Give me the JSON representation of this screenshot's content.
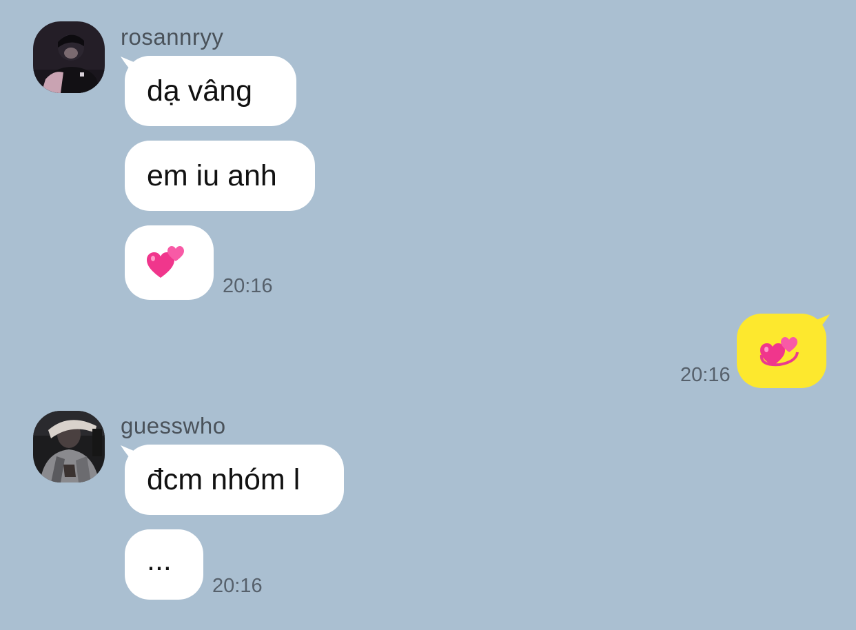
{
  "colors": {
    "background": "#aabfd1",
    "incoming_bubble": "#ffffff",
    "outgoing_bubble": "#fde82e",
    "name_text": "#4a525a",
    "time_text": "#56606b"
  },
  "groups": [
    {
      "sender": "rosannryy",
      "avatar_icon": "profile-photo",
      "messages": [
        {
          "text": "dạ vâng"
        },
        {
          "text": "em iu anh"
        },
        {
          "emoji": "two-hearts-icon"
        }
      ],
      "time": "20:16"
    },
    {
      "sender": "me",
      "outgoing": true,
      "messages": [
        {
          "emoji": "revolving-hearts-icon"
        }
      ],
      "time": "20:16"
    },
    {
      "sender": "guesswho",
      "avatar_icon": "profile-photo",
      "messages": [
        {
          "text": "đcm nhóm l"
        },
        {
          "text": "..."
        }
      ],
      "time": "20:16"
    }
  ]
}
